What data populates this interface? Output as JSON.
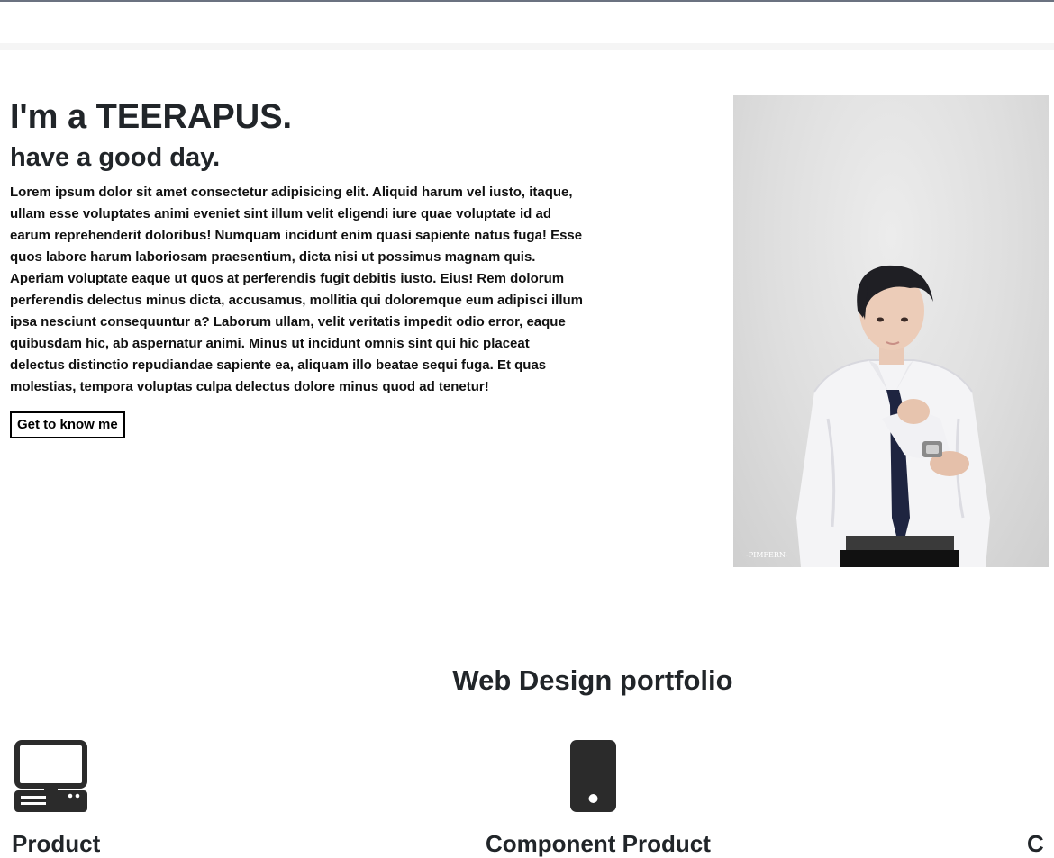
{
  "hero": {
    "title": "I'm a TEERAPUS.",
    "subtitle": "have a good day.",
    "paragraph": "Lorem ipsum dolor sit amet consectetur adipisicing elit. Aliquid harum vel iusto, itaque, ullam esse voluptates animi eveniet sint illum velit eligendi iure quae voluptate id ad earum reprehenderit doloribus! Numquam incidunt enim quasi sapiente natus fuga! Esse quos labore harum laboriosam praesentium, dicta nisi ut possimus magnam quis. Aperiam voluptate eaque ut quos at perferendis fugit debitis iusto. Eius! Rem dolorum perferendis delectus minus dicta, accusamus, mollitia qui doloremque eum adipisci illum ipsa nesciunt consequuntur a? Laborum ullam, velit veritatis impedit odio error, eaque quibusdam hic, ab aspernatur animi. Minus ut incidunt omnis sint qui hic placeat delectus distinctio repudiandae sapiente ea, aliquam illo beatae sequi fuga. Et quas molestias, tempora voluptas culpa delectus dolore minus quod ad tenetur!",
    "cta_label": "Get to know me",
    "photo_watermark": "-PIMFERN-"
  },
  "portfolio": {
    "title": "Web Design portfolio",
    "cards": [
      {
        "icon": "desktop-computer-icon",
        "label": "Product"
      },
      {
        "icon": "mobile-phone-icon",
        "label": "Component Product"
      },
      {
        "icon": "",
        "label": "C"
      }
    ]
  },
  "colors": {
    "heading": "#212529",
    "icon": "#2b2b2b",
    "button_border": "#000000"
  }
}
